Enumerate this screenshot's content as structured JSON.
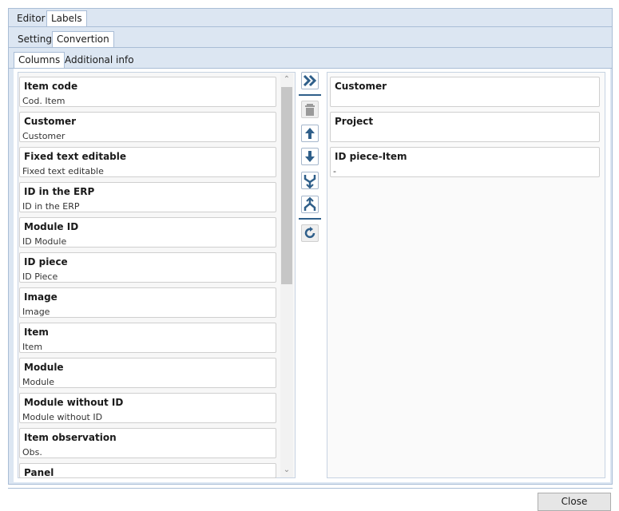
{
  "tabs_top": [
    {
      "label": "Editor",
      "selected": false
    },
    {
      "label": "Labels",
      "selected": true
    }
  ],
  "tabs_mid": [
    {
      "label": "Setting",
      "selected": false
    },
    {
      "label": "Convertion",
      "selected": true
    }
  ],
  "tabs_low": [
    {
      "label": "Columns",
      "selected": true
    },
    {
      "label": "Additional info",
      "selected": false
    }
  ],
  "available_columns": [
    {
      "title": "Item code",
      "subtitle": "Cod. Item"
    },
    {
      "title": "Customer",
      "subtitle": "Customer"
    },
    {
      "title": "Fixed text editable",
      "subtitle": "Fixed text editable"
    },
    {
      "title": "ID in the ERP",
      "subtitle": "ID in the ERP"
    },
    {
      "title": "Module ID",
      "subtitle": "ID Module"
    },
    {
      "title": "ID piece",
      "subtitle": "ID Piece"
    },
    {
      "title": "Image",
      "subtitle": "Image"
    },
    {
      "title": "Item",
      "subtitle": "Item"
    },
    {
      "title": "Module",
      "subtitle": "Module"
    },
    {
      "title": "Module without ID",
      "subtitle": "Module without ID"
    },
    {
      "title": "Item observation",
      "subtitle": "Obs."
    },
    {
      "title": "Panel",
      "subtitle": ""
    }
  ],
  "selected_columns": [
    {
      "title": "Customer",
      "subtitle": ""
    },
    {
      "title": "Project",
      "subtitle": ""
    },
    {
      "title": "ID piece-Item",
      "subtitle": "-"
    }
  ],
  "toolbar_icons": [
    "double-chevron-right-icon",
    "trash-icon",
    "arrow-up-icon",
    "arrow-down-icon",
    "merge-icon",
    "split-icon",
    "refresh-icon"
  ],
  "buttons": {
    "close": "Close"
  },
  "colors": {
    "frame_bg": "#dce6f2",
    "accent": "#2f5f8a",
    "border": "#a9bdd6"
  }
}
